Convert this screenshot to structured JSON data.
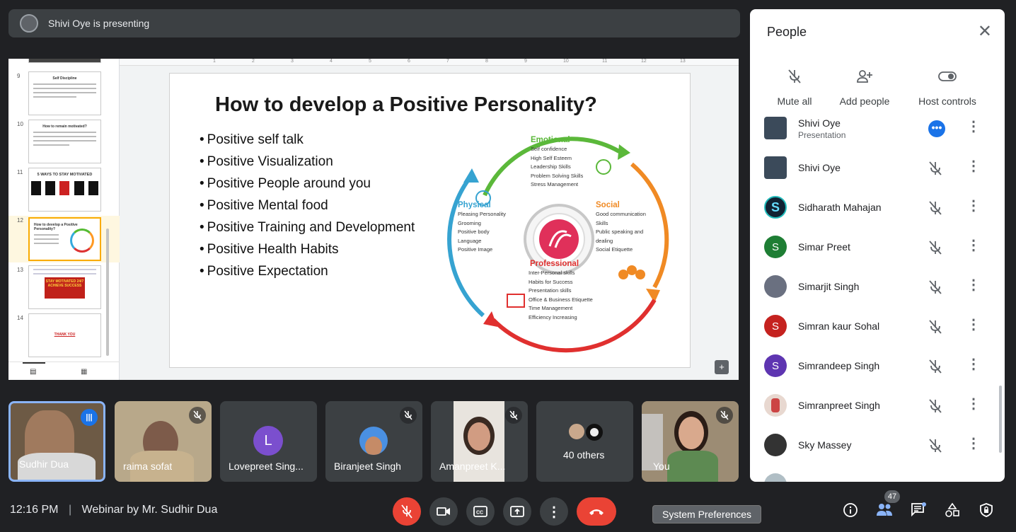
{
  "presenter_bar": {
    "text": "Shivi Oye is presenting"
  },
  "thumbnails": [
    {
      "num": "9",
      "title": "Self Discipline"
    },
    {
      "num": "10",
      "title": "How to remain motivated?"
    },
    {
      "num": "11",
      "title": "5 WAYS TO STAY MOTIVATED"
    },
    {
      "num": "12",
      "title": "How to develop a Positive Personality?"
    },
    {
      "num": "13",
      "title": "STAY MOTIVATED 24/7 ACHIEVE SUCCESS"
    },
    {
      "num": "14",
      "title": "THANK YOU"
    }
  ],
  "ruler_ticks": [
    "1",
    "2",
    "3",
    "4",
    "5",
    "6",
    "7",
    "8",
    "9",
    "10",
    "11",
    "12",
    "13"
  ],
  "slide": {
    "title": "How to develop a Positive Personality?",
    "bullets": [
      "Positive self talk",
      "Positive Visualization",
      "Positive People around you",
      "Positive Mental food",
      "Positive Training and Development",
      "Positive Health Habits",
      "Positive Expectation"
    ],
    "emotional": {
      "heading": "Emotional",
      "items": [
        "Self confidence",
        "High Self Esteem",
        "Leadership Skills",
        "Problem Solving Skills",
        "Stress Management"
      ]
    },
    "physical": {
      "heading": "Physical",
      "items": [
        "Pleasing Personality",
        "Grooming",
        "Positive body",
        "Language",
        "Positive Image"
      ]
    },
    "social": {
      "heading": "Social",
      "items": [
        "Good communication",
        "Skills",
        "Public speaking and",
        "dealing",
        "Social Etiquette"
      ]
    },
    "professional": {
      "heading": "Professional",
      "items": [
        "Inter-Personal skills",
        "Habits for Success",
        "Presentation skills",
        "Office & Business Etiquette",
        "Time Management",
        "Efficiency Increasing"
      ]
    }
  },
  "tiles": [
    {
      "name": "Sudhir Dua"
    },
    {
      "name": "raima sofat"
    },
    {
      "name": "Lovepreet Sing...",
      "initial": "L"
    },
    {
      "name": "Biranjeet Singh"
    },
    {
      "name": "Amanpreet K..."
    },
    {
      "name": "40 others"
    },
    {
      "name": "You"
    }
  ],
  "panel": {
    "title": "People",
    "actions": {
      "mute_all": "Mute all",
      "add_people": "Add people",
      "host_controls": "Host controls"
    },
    "people": [
      {
        "name": "Shivi Oye",
        "sub": "Presentation"
      },
      {
        "name": "Shivi Oye"
      },
      {
        "name": "Sidharath Mahajan"
      },
      {
        "name": "Simar Preet",
        "initial": "S"
      },
      {
        "name": "Simarjit Singh"
      },
      {
        "name": "Simran kaur Sohal",
        "initial": "S"
      },
      {
        "name": "Simrandeep Singh",
        "initial": "S"
      },
      {
        "name": "Simranpreet Singh"
      },
      {
        "name": "Sky Massey"
      }
    ]
  },
  "bottom": {
    "time": "12:16 PM",
    "meeting": "Webinar by Mr. Sudhir Dua",
    "tooltip": "System Preferences",
    "participant_count": "47"
  },
  "colors": {
    "end_call": "#ea4335",
    "mic_off": "#ea4335",
    "active_speaker": "#8ab4f8",
    "emotional": "#5bb83a",
    "social": "#f08a24",
    "professional": "#e0302f",
    "physical": "#36a3d1"
  }
}
